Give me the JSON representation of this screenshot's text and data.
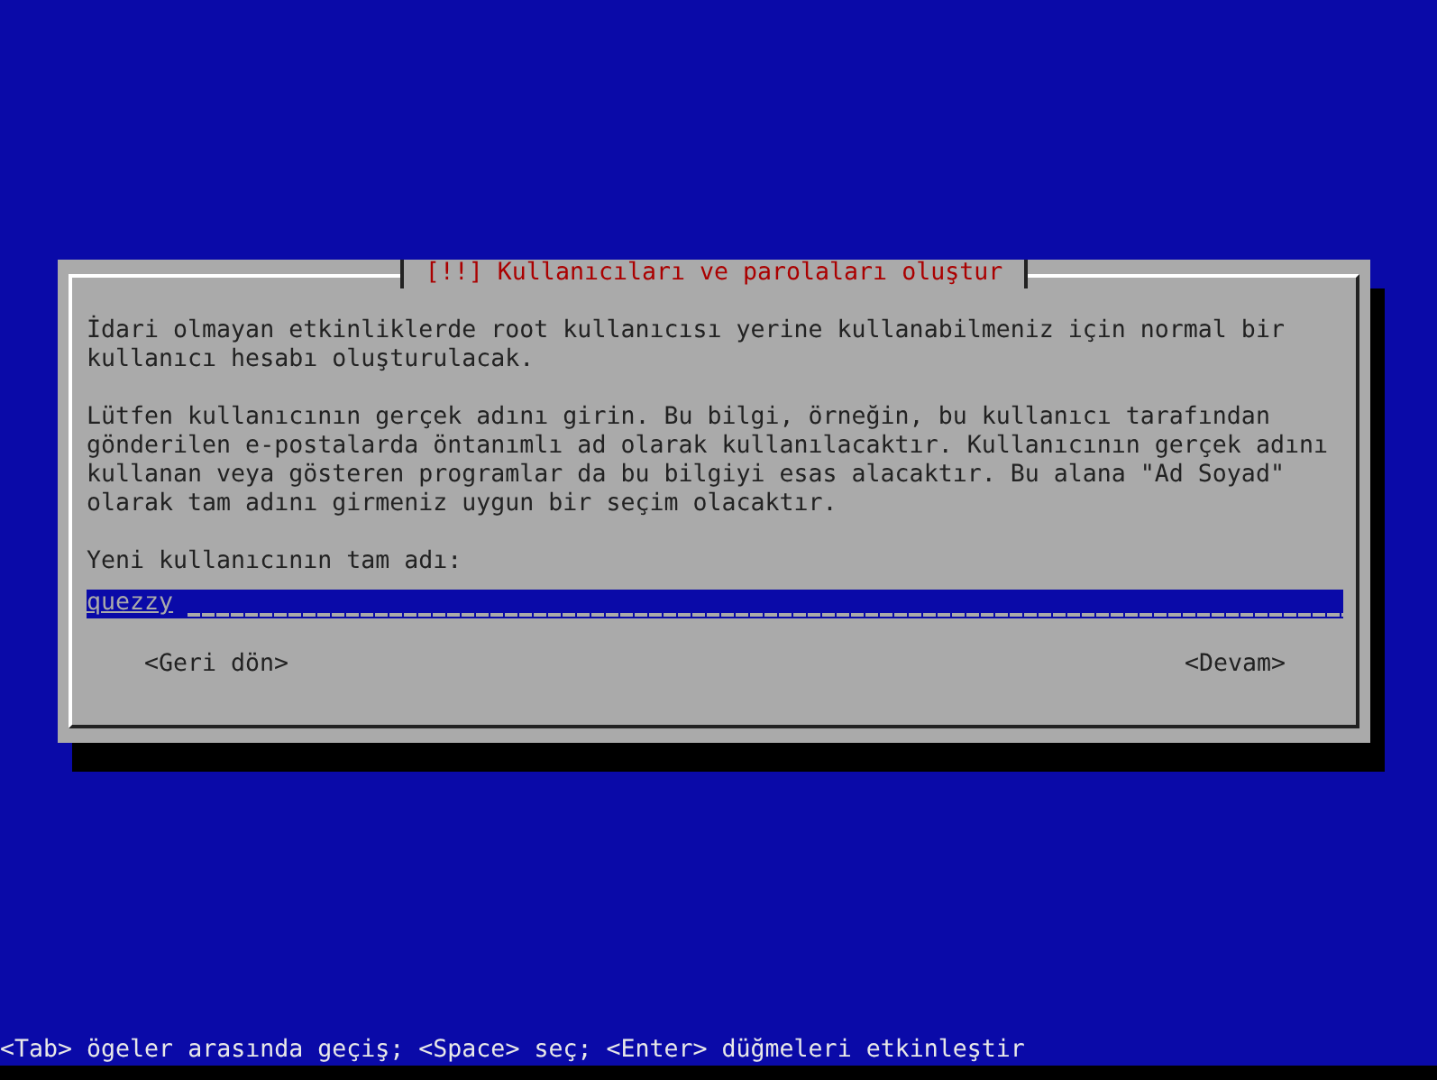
{
  "dialog": {
    "title": "[!!] Kullanıcıları ve parolaları oluştur",
    "paragraphs": [
      "İdari olmayan etkinliklerde root kullanıcısı yerine kullanabilmeniz için normal bir kullanıcı hesabı oluşturulacak.",
      "Lütfen kullanıcının gerçek adını girin. Bu bilgi, örneğin, bu kullanıcı tarafından gönderilen e-postalarda öntanımlı ad olarak kullanılacaktır. Kullanıcının gerçek adını kullanan veya gösteren programlar da bu bilgiyi esas alacaktır. Bu alana \"Ad Soyad\" olarak tam adını girmeniz uygun bir seçim olacaktır."
    ],
    "field": {
      "label": "Yeni kullanıcının tam adı:",
      "value": "quezzy",
      "selected": true
    },
    "buttons": [
      {
        "label": "<Geri dön>",
        "selected": false
      },
      {
        "label": "<Devam>",
        "selected": false
      }
    ]
  },
  "status_bar": "<Tab> ögeler arasında geçiş; <Space> seç; <Enter> düğmeleri etkinleştir"
}
